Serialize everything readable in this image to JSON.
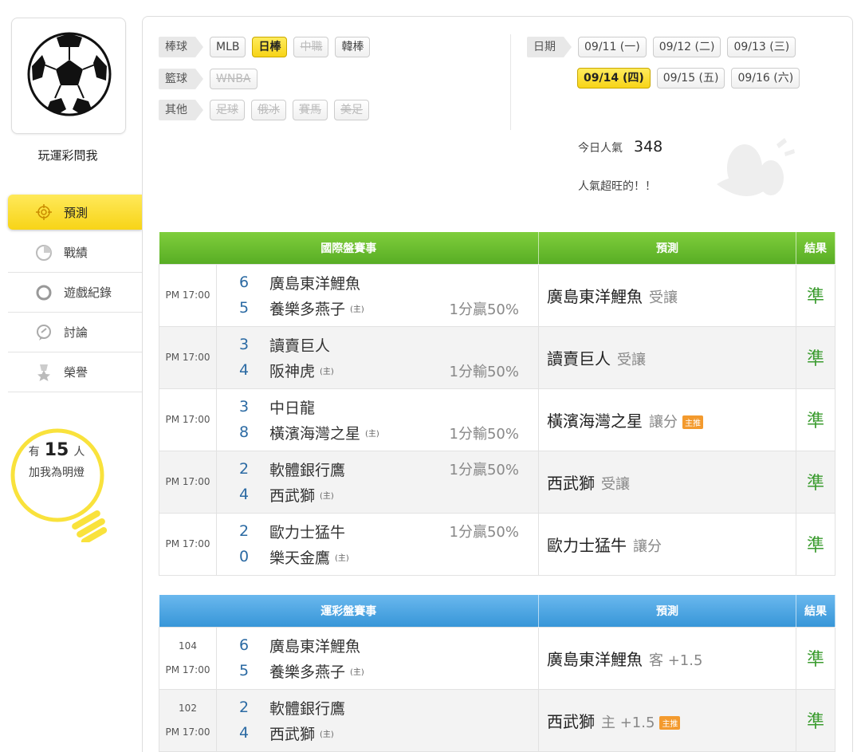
{
  "sidebar": {
    "username": "玩運彩問我",
    "nav": [
      {
        "label": "預測",
        "icon": "target-icon",
        "active": true
      },
      {
        "label": "戰績",
        "icon": "chart-icon",
        "active": false
      },
      {
        "label": "遊戲紀錄",
        "icon": "ring-icon",
        "active": false
      },
      {
        "label": "討論",
        "icon": "chat-icon",
        "active": false
      },
      {
        "label": "榮譽",
        "icon": "medal-icon",
        "active": false
      }
    ],
    "fan": {
      "prefix": "有",
      "count": "15",
      "suffix": "人",
      "cta": "加我為明燈"
    }
  },
  "filters": {
    "baseball": {
      "label": "棒球",
      "chips": [
        "MLB",
        "日棒",
        "中職",
        "韓棒"
      ]
    },
    "basketball": {
      "label": "籃球",
      "chips": [
        "WNBA"
      ]
    },
    "other": {
      "label": "其他",
      "chips": [
        "足球",
        "俄冰",
        "賽馬",
        "美足"
      ]
    },
    "date": {
      "label": "日期",
      "dates": [
        "09/11 (一)",
        "09/12 (二)",
        "09/13 (三)",
        "09/14 (四)",
        "09/15 (五)",
        "09/16 (六)"
      ]
    }
  },
  "popularity": {
    "label": "今日人氣",
    "count": "348",
    "message": "人氣超旺的！！"
  },
  "intl_table": {
    "headers": [
      "國際盤賽事",
      "預測",
      "結果"
    ],
    "rows": [
      {
        "time": "PM 17:00",
        "s1": "6",
        "t1": "廣島東洋鯉魚",
        "s2": "5",
        "t2": "養樂多燕子",
        "host": "(主)",
        "odds": "1分贏50%",
        "pred": "廣島東洋鯉魚",
        "pred_sub": "受讓",
        "result": "準"
      },
      {
        "time": "PM 17:00",
        "s1": "3",
        "t1": "讀賣巨人",
        "s2": "4",
        "t2": "阪神虎",
        "host": "(主)",
        "odds": "1分輸50%",
        "pred": "讀賣巨人",
        "pred_sub": "受讓",
        "result": "準"
      },
      {
        "time": "PM 17:00",
        "s1": "3",
        "t1": "中日龍",
        "s2": "8",
        "t2": "橫濱海灣之星",
        "host": "(主)",
        "odds": "1分輸50%",
        "pred": "橫濱海灣之星",
        "pred_sub": "讓分",
        "badge": "主推",
        "result": "準"
      },
      {
        "time": "PM 17:00",
        "s1": "2",
        "t1": "軟體銀行鷹",
        "s2": "4",
        "t2": "西武獅",
        "host": "(主)",
        "odds": "1分贏50%",
        "pred": "西武獅",
        "pred_sub": "受讓",
        "result": "準"
      },
      {
        "time": "PM 17:00",
        "s1": "2",
        "t1": "歐力士猛牛",
        "s2": "0",
        "t2": "樂天金鷹",
        "host": "(主)",
        "odds": "1分贏50%",
        "pred": "歐力士猛牛",
        "pred_sub": "讓分",
        "result": "準"
      }
    ]
  },
  "lottery_table": {
    "headers": [
      "運彩盤賽事",
      "預測",
      "結果"
    ],
    "rows": [
      {
        "code": "104",
        "time": "PM 17:00",
        "s1": "6",
        "t1": "廣島東洋鯉魚",
        "s2": "5",
        "t2": "養樂多燕子",
        "host": "(主)",
        "pred": "廣島東洋鯉魚",
        "pred_sub": "客 +1.5",
        "result": "準"
      },
      {
        "code": "102",
        "time": "PM 17:00",
        "s1": "2",
        "t1": "軟體銀行鷹",
        "s2": "4",
        "t2": "西武獅",
        "host": "(主)",
        "pred": "西武獅",
        "pred_sub": "主 +1.5",
        "badge": "主推",
        "result": "準"
      }
    ]
  },
  "colors": {
    "accent_yellow": "#f7d417",
    "header_green": "#6cbd30",
    "header_blue": "#4aa6e4",
    "result_green": "#3a9b2e",
    "score_blue": "#2b6aa3"
  }
}
